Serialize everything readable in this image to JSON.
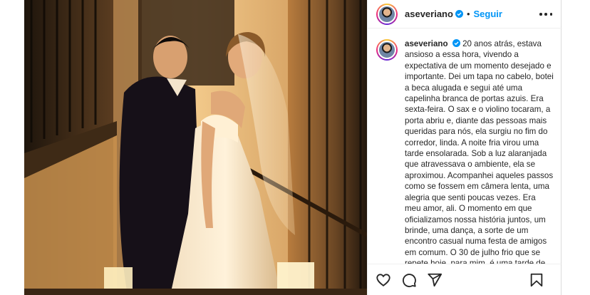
{
  "post": {
    "photo_alt": "",
    "author": {
      "username": "aseveriano",
      "verified": true
    },
    "header": {
      "separator": "•",
      "follow_label": "Seguir",
      "more_icon": "more-options-icon"
    },
    "caption": {
      "username": "aseveriano",
      "text": "20 anos atrás, estava ansioso a essa hora, vivendo a expectativa de um momento desejado e importante. Dei um tapa no cabelo, botei a beca alugada e segui até uma capelinha branca de portas azuis. Era sexta-feira. O sax e o violino tocaram, a porta abriu e, diante das pessoas mais queridas para nós, ela surgiu no fim do corredor, linda. A noite fria virou uma tarde ensolarada. Sob a luz alaranjada que atravessava o ambiente, ela se aproximou. Acompanhei aqueles passos como se fossem em câmera lenta, uma alegria que senti poucas vezes. Era meu amor, ali. O momento em que oficializamos nossa história juntos, um brinde, uma dança, a sorte de um encontro casual numa festa de amigos em comum. O 30 de julho frio que se repete hoje, para mim, é uma tarde de sol. Tarde"
    },
    "actions": [
      "heart-icon",
      "comment-icon",
      "share-icon",
      "bookmark-icon"
    ],
    "colors": {
      "follow": "#0095f6",
      "verified": "#0095f6",
      "text": "#262626"
    }
  }
}
